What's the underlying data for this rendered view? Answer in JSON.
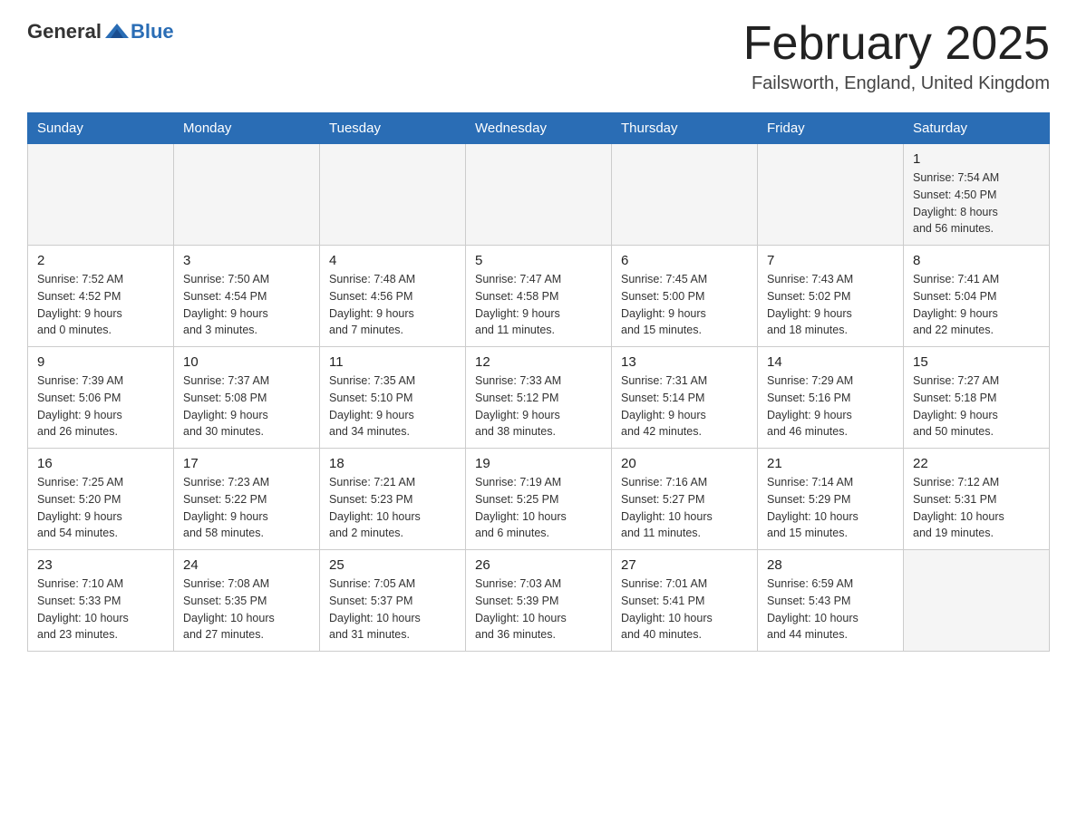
{
  "header": {
    "logo": {
      "general": "General",
      "blue": "Blue"
    },
    "title": "February 2025",
    "location": "Failsworth, England, United Kingdom"
  },
  "calendar": {
    "weekdays": [
      "Sunday",
      "Monday",
      "Tuesday",
      "Wednesday",
      "Thursday",
      "Friday",
      "Saturday"
    ],
    "weeks": [
      [
        {
          "day": "",
          "info": ""
        },
        {
          "day": "",
          "info": ""
        },
        {
          "day": "",
          "info": ""
        },
        {
          "day": "",
          "info": ""
        },
        {
          "day": "",
          "info": ""
        },
        {
          "day": "",
          "info": ""
        },
        {
          "day": "1",
          "info": "Sunrise: 7:54 AM\nSunset: 4:50 PM\nDaylight: 8 hours\nand 56 minutes."
        }
      ],
      [
        {
          "day": "2",
          "info": "Sunrise: 7:52 AM\nSunset: 4:52 PM\nDaylight: 9 hours\nand 0 minutes."
        },
        {
          "day": "3",
          "info": "Sunrise: 7:50 AM\nSunset: 4:54 PM\nDaylight: 9 hours\nand 3 minutes."
        },
        {
          "day": "4",
          "info": "Sunrise: 7:48 AM\nSunset: 4:56 PM\nDaylight: 9 hours\nand 7 minutes."
        },
        {
          "day": "5",
          "info": "Sunrise: 7:47 AM\nSunset: 4:58 PM\nDaylight: 9 hours\nand 11 minutes."
        },
        {
          "day": "6",
          "info": "Sunrise: 7:45 AM\nSunset: 5:00 PM\nDaylight: 9 hours\nand 15 minutes."
        },
        {
          "day": "7",
          "info": "Sunrise: 7:43 AM\nSunset: 5:02 PM\nDaylight: 9 hours\nand 18 minutes."
        },
        {
          "day": "8",
          "info": "Sunrise: 7:41 AM\nSunset: 5:04 PM\nDaylight: 9 hours\nand 22 minutes."
        }
      ],
      [
        {
          "day": "9",
          "info": "Sunrise: 7:39 AM\nSunset: 5:06 PM\nDaylight: 9 hours\nand 26 minutes."
        },
        {
          "day": "10",
          "info": "Sunrise: 7:37 AM\nSunset: 5:08 PM\nDaylight: 9 hours\nand 30 minutes."
        },
        {
          "day": "11",
          "info": "Sunrise: 7:35 AM\nSunset: 5:10 PM\nDaylight: 9 hours\nand 34 minutes."
        },
        {
          "day": "12",
          "info": "Sunrise: 7:33 AM\nSunset: 5:12 PM\nDaylight: 9 hours\nand 38 minutes."
        },
        {
          "day": "13",
          "info": "Sunrise: 7:31 AM\nSunset: 5:14 PM\nDaylight: 9 hours\nand 42 minutes."
        },
        {
          "day": "14",
          "info": "Sunrise: 7:29 AM\nSunset: 5:16 PM\nDaylight: 9 hours\nand 46 minutes."
        },
        {
          "day": "15",
          "info": "Sunrise: 7:27 AM\nSunset: 5:18 PM\nDaylight: 9 hours\nand 50 minutes."
        }
      ],
      [
        {
          "day": "16",
          "info": "Sunrise: 7:25 AM\nSunset: 5:20 PM\nDaylight: 9 hours\nand 54 minutes."
        },
        {
          "day": "17",
          "info": "Sunrise: 7:23 AM\nSunset: 5:22 PM\nDaylight: 9 hours\nand 58 minutes."
        },
        {
          "day": "18",
          "info": "Sunrise: 7:21 AM\nSunset: 5:23 PM\nDaylight: 10 hours\nand 2 minutes."
        },
        {
          "day": "19",
          "info": "Sunrise: 7:19 AM\nSunset: 5:25 PM\nDaylight: 10 hours\nand 6 minutes."
        },
        {
          "day": "20",
          "info": "Sunrise: 7:16 AM\nSunset: 5:27 PM\nDaylight: 10 hours\nand 11 minutes."
        },
        {
          "day": "21",
          "info": "Sunrise: 7:14 AM\nSunset: 5:29 PM\nDaylight: 10 hours\nand 15 minutes."
        },
        {
          "day": "22",
          "info": "Sunrise: 7:12 AM\nSunset: 5:31 PM\nDaylight: 10 hours\nand 19 minutes."
        }
      ],
      [
        {
          "day": "23",
          "info": "Sunrise: 7:10 AM\nSunset: 5:33 PM\nDaylight: 10 hours\nand 23 minutes."
        },
        {
          "day": "24",
          "info": "Sunrise: 7:08 AM\nSunset: 5:35 PM\nDaylight: 10 hours\nand 27 minutes."
        },
        {
          "day": "25",
          "info": "Sunrise: 7:05 AM\nSunset: 5:37 PM\nDaylight: 10 hours\nand 31 minutes."
        },
        {
          "day": "26",
          "info": "Sunrise: 7:03 AM\nSunset: 5:39 PM\nDaylight: 10 hours\nand 36 minutes."
        },
        {
          "day": "27",
          "info": "Sunrise: 7:01 AM\nSunset: 5:41 PM\nDaylight: 10 hours\nand 40 minutes."
        },
        {
          "day": "28",
          "info": "Sunrise: 6:59 AM\nSunset: 5:43 PM\nDaylight: 10 hours\nand 44 minutes."
        },
        {
          "day": "",
          "info": ""
        }
      ]
    ]
  }
}
